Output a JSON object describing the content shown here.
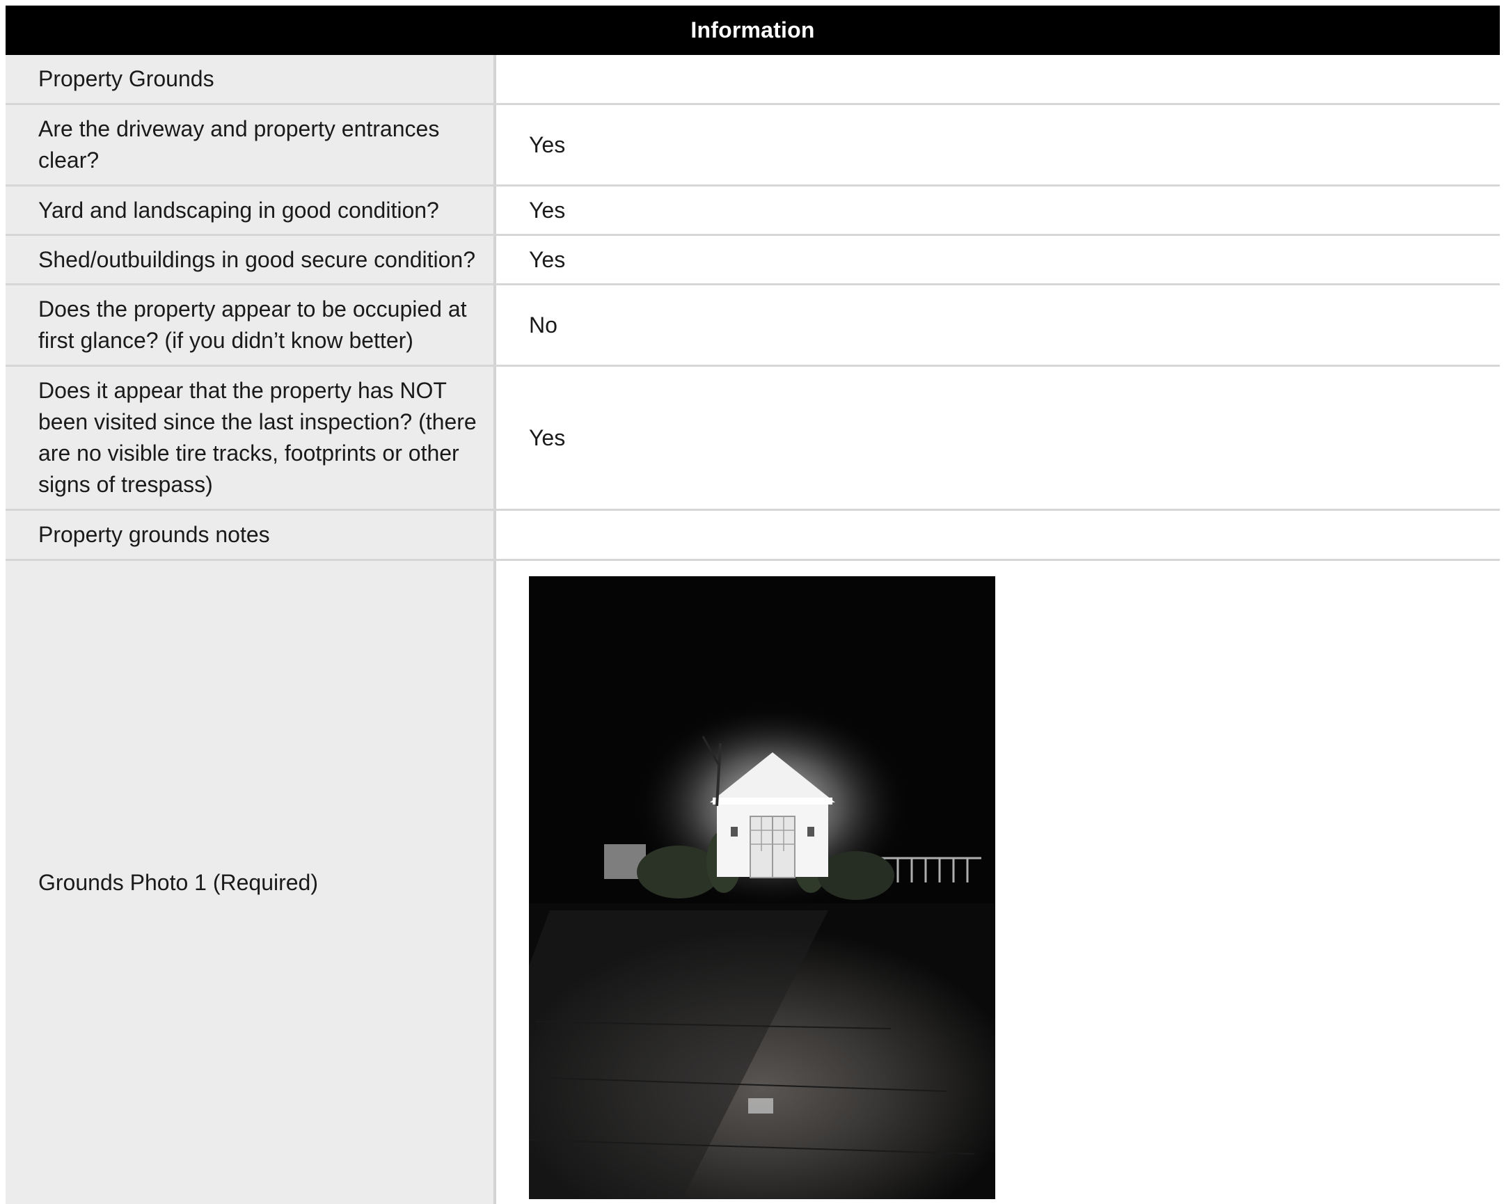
{
  "header": {
    "title": "Information"
  },
  "rows": [
    {
      "label": "Property Grounds",
      "value": ""
    },
    {
      "label": "Are the driveway and property entrances clear?",
      "value": "Yes"
    },
    {
      "label": "Yard and landscaping in good condition?",
      "value": "Yes"
    },
    {
      "label": "Shed/outbuildings in good secure condition?",
      "value": "Yes"
    },
    {
      "label": "Does the property appear to be occupied at first glance? (if you didn’t know better)",
      "value": "No"
    },
    {
      "label": "Does it appear that the property has NOT been visited since the last inspection? (there are no visible tire tracks, footprints or other signs of trespass)",
      "value": "Yes"
    },
    {
      "label": "Property grounds notes",
      "value": ""
    },
    {
      "label": "Grounds Photo 1 (Required)",
      "value": ""
    }
  ],
  "photo": {
    "subject": "illuminated white shed at night with driveway and fence"
  }
}
